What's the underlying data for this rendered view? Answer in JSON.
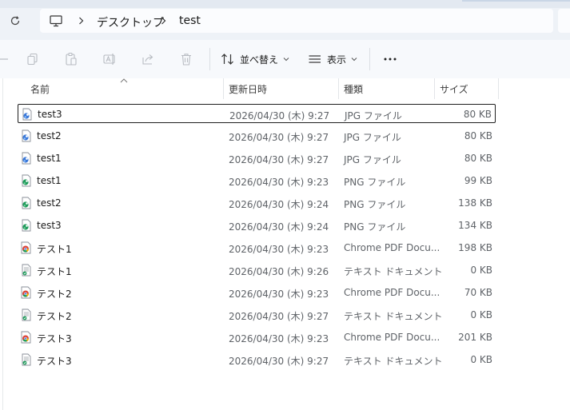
{
  "address_bar": {
    "breadcrumbs": [
      "デスクトップ",
      "test"
    ]
  },
  "command_bar": {
    "sort_label": "並べ替え",
    "view_label": "表示"
  },
  "columns": {
    "name": "名前",
    "modified": "更新日時",
    "type": "種類",
    "size": "サイズ"
  },
  "files": [
    {
      "name": "test3",
      "date": "2026/04/30 (木) 9:27",
      "type": "JPG ファイル",
      "size": "80 KB",
      "icon": "jpg-file-icon",
      "selected": true
    },
    {
      "name": "test2",
      "date": "2026/04/30 (木) 9:27",
      "type": "JPG ファイル",
      "size": "80 KB",
      "icon": "jpg-file-icon",
      "selected": false
    },
    {
      "name": "test1",
      "date": "2026/04/30 (木) 9:27",
      "type": "JPG ファイル",
      "size": "80 KB",
      "icon": "jpg-file-icon",
      "selected": false
    },
    {
      "name": "test1",
      "date": "2026/04/30 (木) 9:23",
      "type": "PNG ファイル",
      "size": "99 KB",
      "icon": "png-file-icon",
      "selected": false
    },
    {
      "name": "test2",
      "date": "2026/04/30 (木) 9:24",
      "type": "PNG ファイル",
      "size": "138 KB",
      "icon": "png-file-icon",
      "selected": false
    },
    {
      "name": "test3",
      "date": "2026/04/30 (木) 9:24",
      "type": "PNG ファイル",
      "size": "134 KB",
      "icon": "png-file-icon",
      "selected": false
    },
    {
      "name": "テスト1",
      "date": "2026/04/30 (木) 9:23",
      "type": "Chrome PDF Docu...",
      "size": "198 KB",
      "icon": "chrome-pdf-icon",
      "selected": false
    },
    {
      "name": "テスト1",
      "date": "2026/04/30 (木) 9:26",
      "type": "テキスト ドキュメント",
      "size": "0 KB",
      "icon": "text-document-icon",
      "selected": false
    },
    {
      "name": "テスト2",
      "date": "2026/04/30 (木) 9:23",
      "type": "Chrome PDF Docu...",
      "size": "70 KB",
      "icon": "chrome-pdf-icon",
      "selected": false
    },
    {
      "name": "テスト2",
      "date": "2026/04/30 (木) 9:27",
      "type": "テキスト ドキュメント",
      "size": "0 KB",
      "icon": "text-document-icon",
      "selected": false
    },
    {
      "name": "テスト3",
      "date": "2026/04/30 (木) 9:23",
      "type": "Chrome PDF Docu...",
      "size": "201 KB",
      "icon": "chrome-pdf-icon",
      "selected": false
    },
    {
      "name": "テスト3",
      "date": "2026/04/30 (木) 9:27",
      "type": "テキスト ドキュメント",
      "size": "0 KB",
      "icon": "text-document-icon",
      "selected": false
    }
  ]
}
